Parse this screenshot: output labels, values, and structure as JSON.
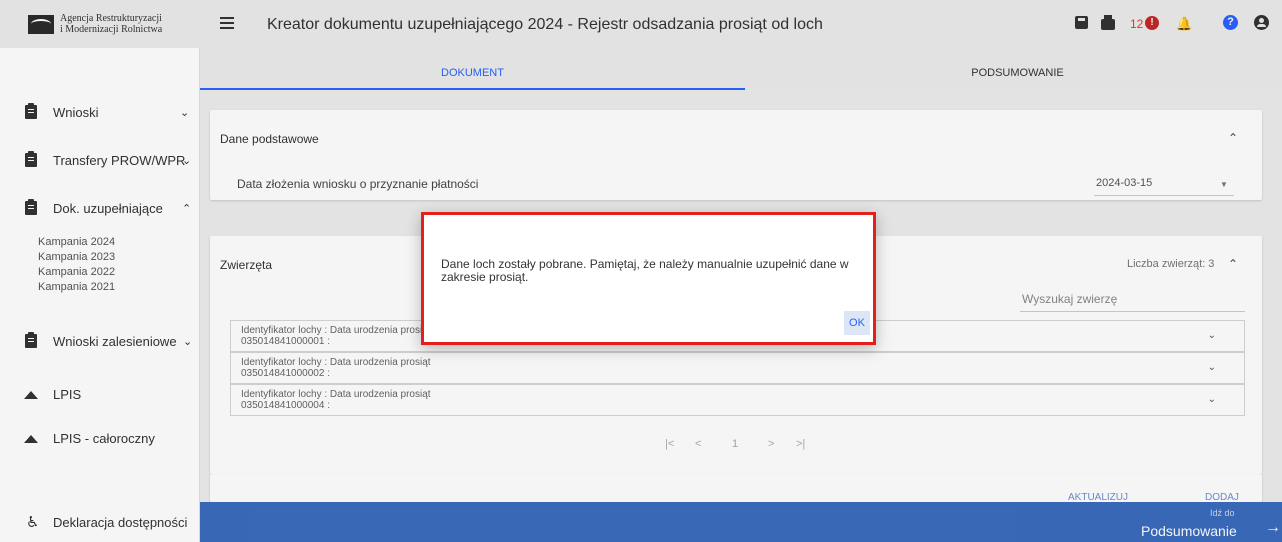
{
  "logo": {
    "line1": "Agencja Restrukturyzacji",
    "line2": "i Modernizacji Rolnictwa"
  },
  "header": {
    "title": "Kreator dokumentu uzupełniającego 2024 - Rejestr odsadzania prosiąt od loch",
    "notification_count": "12",
    "alert_glyph": "!",
    "help_glyph": "?"
  },
  "icons": {
    "save": "save-icon",
    "print": "print-icon",
    "alert": "alert-icon",
    "bell": "bell-icon",
    "help": "help-icon",
    "user": "user-icon",
    "menu": "menu-icon"
  },
  "colors": {
    "primary": "#2962ff",
    "bottom_bar": "#3a6cbd",
    "alert": "#c62828",
    "modal_border": "#e3201b"
  },
  "tabs": [
    {
      "label": "DOKUMENT",
      "active": true
    },
    {
      "label": "PODSUMOWANIE",
      "active": false
    }
  ],
  "sidebar": {
    "items": [
      {
        "label": "Wnioski",
        "chevron": "⌄"
      },
      {
        "label": "Transfery PROW/WPR",
        "chevron": "⌄"
      },
      {
        "label": "Dok. uzupełniające",
        "chevron": "⌃"
      },
      {
        "label": "Wnioski zalesieniowe",
        "chevron": "⌄"
      },
      {
        "label": "LPIS"
      },
      {
        "label": "LPIS - całoroczny"
      },
      {
        "label": "Deklaracja dostępności"
      }
    ],
    "campaigns": [
      "Kampania 2024",
      "Kampania 2023",
      "Kampania 2022",
      "Kampania 2021"
    ]
  },
  "basic_data": {
    "title": "Dane podstawowe",
    "field_label": "Data złożenia wniosku o przyznanie płatności",
    "date_value": "2024-03-15"
  },
  "animals": {
    "title": "Zwierzęta",
    "count_label": "Liczba zwierząt: 3",
    "search_placeholder": "Wyszukaj zwierzę",
    "rows": [
      {
        "line1": "Identyfikator lochy : Data urodzenia prosiąt",
        "line2": "035014841000001 :"
      },
      {
        "line1": "Identyfikator lochy : Data urodzenia prosiąt",
        "line2": "035014841000002 :"
      },
      {
        "line1": "Identyfikator lochy : Data urodzenia prosiąt",
        "line2": "035014841000004 :"
      }
    ],
    "pager": {
      "first": "|<",
      "prev": "<",
      "page": "1",
      "next": ">",
      "last": ">|"
    }
  },
  "bottom": {
    "goto_small": "Idź do",
    "goto_big": "Podsumowanie",
    "arrow": "→",
    "ghost_update": "AKTUALIZUJ",
    "ghost_add": "DODAJ"
  },
  "modal": {
    "message": "Dane loch zostały pobrane. Pamiętaj, że należy manualnie uzupełnić dane w zakresie prosiąt.",
    "ok_label": "OK"
  }
}
